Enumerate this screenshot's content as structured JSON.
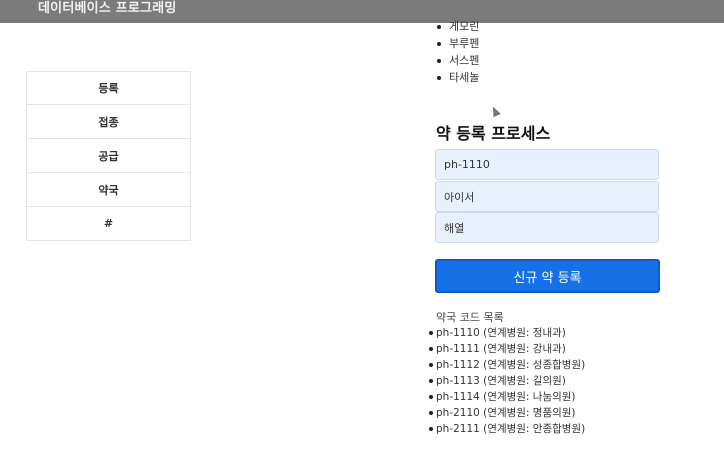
{
  "app": {
    "title": "데이터베이스 프로그래밍"
  },
  "sidebar": {
    "items": [
      {
        "label": "등록"
      },
      {
        "label": "접종"
      },
      {
        "label": "공급"
      },
      {
        "label": "약국"
      },
      {
        "label": "#"
      }
    ]
  },
  "vaccine_list": {
    "items": [
      "게모린",
      "부루펜",
      "서스펜",
      "타세놀"
    ]
  },
  "register_form": {
    "title": "약 등록 프로세스",
    "code_value": "ph-1110",
    "name_value": "아이서",
    "effect_value": "해열",
    "submit_label": "신규 약 등록"
  },
  "pharmacy_codes": {
    "heading": "약국 코드 목록",
    "items": [
      {
        "code": "ph-1110",
        "hospital": " (연계병원: 정내과)"
      },
      {
        "code": "ph-1111",
        "hospital": " (연계병원: 강내과)"
      },
      {
        "code": "ph-1112",
        "hospital": " (연계병원: 성종합병원)"
      },
      {
        "code": "ph-1113",
        "hospital": " (연계병원: 길의원)"
      },
      {
        "code": "ph-1114",
        "hospital": " (연계병원: 나눔의원)"
      },
      {
        "code": "ph-2110",
        "hospital": " (연계병원: 명품의원)"
      },
      {
        "code": "ph-2111",
        "hospital": " (연계병원: 안종합병원)"
      }
    ]
  }
}
